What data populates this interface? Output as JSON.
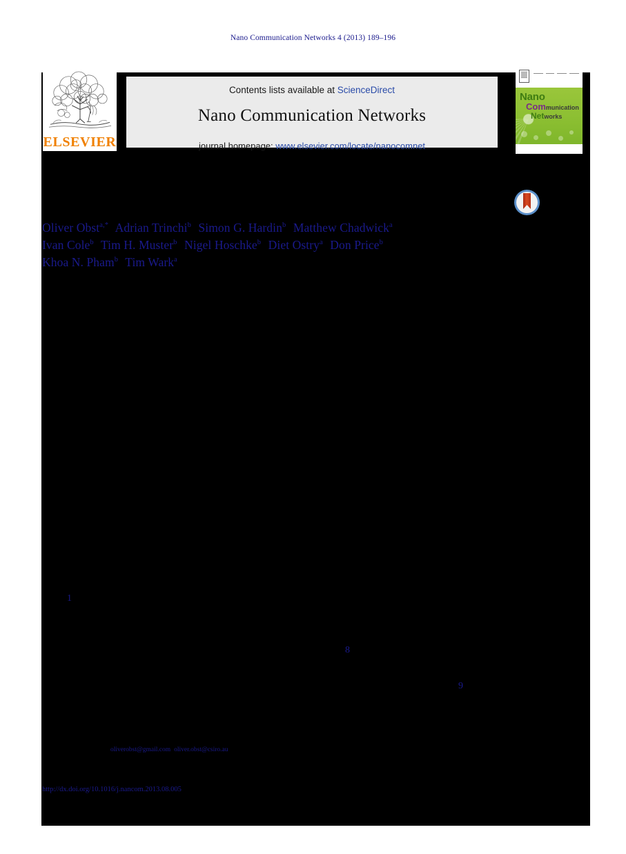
{
  "running_head": "Nano Communication Networks 4 (2013) 189–196",
  "masthead": {
    "publisher_logo": {
      "wordmark": "ELSEVIER",
      "wordmark_color": "#f08000",
      "icon": "elsevier-tree-icon"
    },
    "contents_prefix": "Contents lists available at ",
    "sciencedirect_label": "ScienceDirect",
    "journal_title": "Nano Communication Networks",
    "homepage_prefix": "journal homepage: ",
    "homepage_url": "www.elsevier.com/locate/nanocomnet",
    "band_color": "#ebebeb",
    "link_color": "#2a4ba8",
    "cover": {
      "word1": "Nano",
      "word2_bold": "Com",
      "word2_rest": "munication",
      "word3_bold": "Net",
      "word3_rest": "works",
      "green": "#8cbf32",
      "purple": "#7b2c86"
    }
  },
  "crossmark": {
    "name": "CrossMark",
    "ring_color": "#5b8fc9",
    "ribbon_color": "#c23a1a"
  },
  "authors": {
    "color": "#1a1a8c",
    "lines": [
      [
        {
          "name": "Oliver Obst",
          "aff": "a,*"
        },
        {
          "name": "Adrian Trinchi",
          "aff": "b"
        },
        {
          "name": "Simon G. Hardin",
          "aff": "b"
        },
        {
          "name": "Matthew Chadwick",
          "aff": "a"
        }
      ],
      [
        {
          "name": "Ivan Cole",
          "aff": "b"
        },
        {
          "name": "Tim H. Muster",
          "aff": "b"
        },
        {
          "name": "Nigel Hoschke",
          "aff": "b"
        },
        {
          "name": "Diet Ostry",
          "aff": "a"
        },
        {
          "name": "Don Price",
          "aff": "b"
        }
      ],
      [
        {
          "name": "Khoa N. Pham",
          "aff": "b"
        },
        {
          "name": "Tim Wark",
          "aff": "a"
        }
      ]
    ]
  },
  "body_markers": [
    {
      "label": "1"
    },
    {
      "label": "8"
    },
    {
      "label": "9"
    }
  ],
  "footnote": {
    "email_1": "oliverobst@gmail.com",
    "email_2": "oliver.obst@csiro.au"
  },
  "doi": "http://dx.doi.org/10.1016/j.nancom.2013.08.005"
}
